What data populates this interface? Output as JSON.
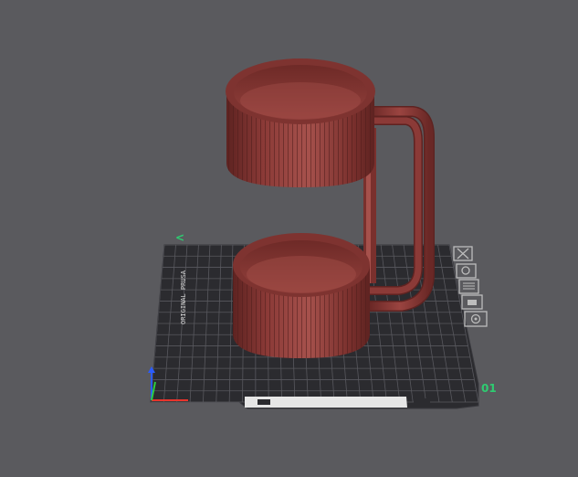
{
  "viewport": {
    "background": "#5a5a5e",
    "bed_color": "#2b2b2f",
    "grid_color": "#5c5c62",
    "model_color": "#8b3a37",
    "model_shadow": "#5e2321",
    "model_highlight": "#a6514c"
  },
  "bed": {
    "corner_label_top": "<",
    "corner_label_right": "01",
    "label_color": "#2ecc71",
    "bed_text": "ORIGINAL PRUSA",
    "plate_text": "PRUSA"
  },
  "axes": {
    "x_color": "#e8342c",
    "y_color": "#2ecc40",
    "z_color": "#2b5cff"
  },
  "toolbar": {
    "items": [
      {
        "name": "close-tool",
        "icon": "close-icon"
      },
      {
        "name": "settings-tool",
        "icon": "gear-icon"
      },
      {
        "name": "list-tool",
        "icon": "list-icon"
      },
      {
        "name": "support-tool",
        "icon": "support-icon"
      },
      {
        "name": "view-tool",
        "icon": "eye-icon"
      }
    ]
  },
  "model": {
    "name": "mug",
    "parts": [
      "upper-cup",
      "lower-cup",
      "handle"
    ]
  }
}
